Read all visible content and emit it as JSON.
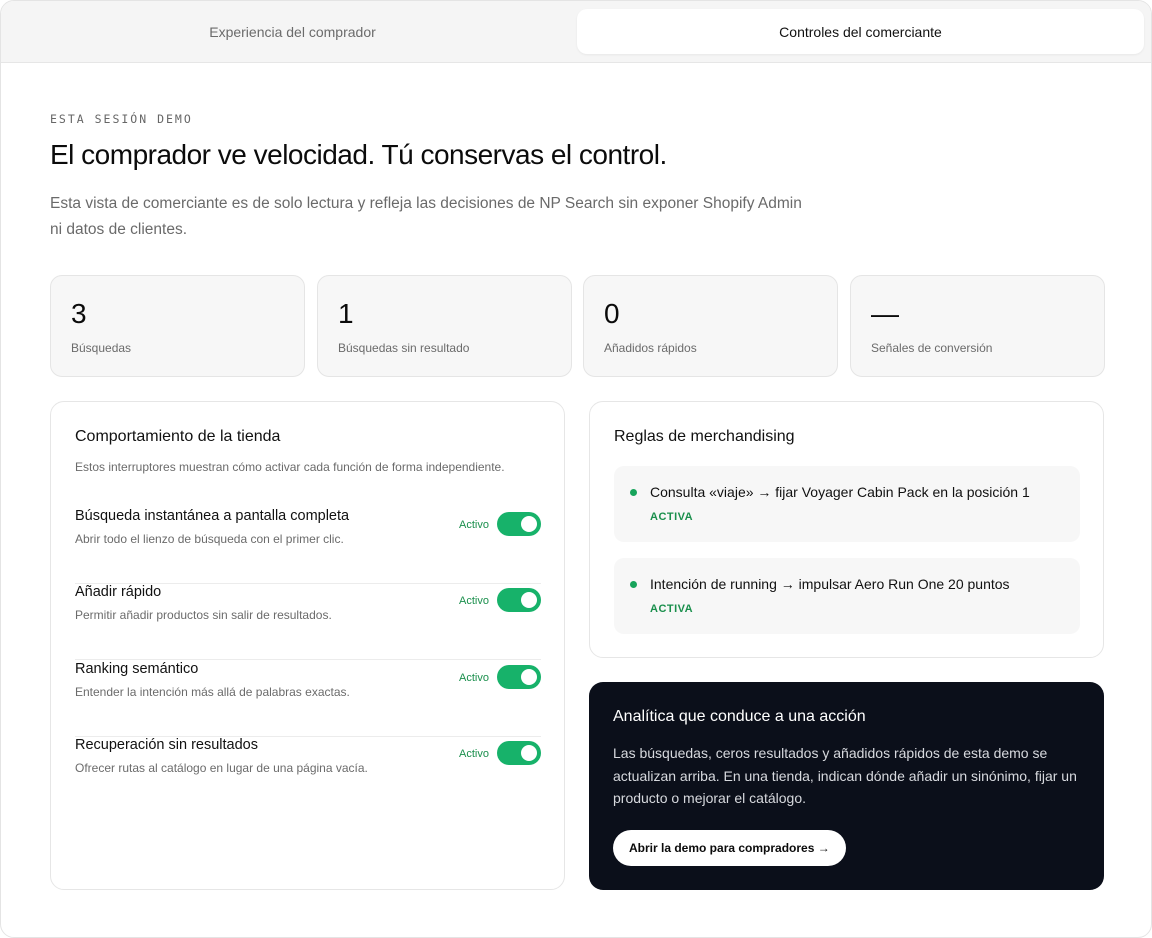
{
  "tabs": [
    {
      "label": "Experiencia del comprador",
      "active": false
    },
    {
      "label": "Controles del comerciante",
      "active": true
    }
  ],
  "header": {
    "eyebrow": "ESTA SESIÓN DEMO",
    "title": "El comprador ve velocidad. Tú conservas el control.",
    "subtitle": "Esta vista de comerciante es de solo lectura y refleja las decisiones de NP Search sin exponer Shopify Admin ni datos de clientes."
  },
  "stats": [
    {
      "value": "3",
      "label": "Búsquedas"
    },
    {
      "value": "1",
      "label": "Búsquedas sin resultado"
    },
    {
      "value": "0",
      "label": "Añadidos rápidos"
    },
    {
      "value": "—",
      "label": "Señales de conversión"
    }
  ],
  "behavior": {
    "title": "Comportamiento de la tienda",
    "subtitle": "Estos interruptores muestran cómo activar cada función de forma independiente.",
    "items": [
      {
        "title": "Búsqueda instantánea a pantalla completa",
        "description": "Abrir todo el lienzo de búsqueda con el primer clic.",
        "status": "Activo",
        "on": true
      },
      {
        "title": "Añadir rápido",
        "description": "Permitir añadir productos sin salir de resultados.",
        "status": "Activo",
        "on": true
      },
      {
        "title": "Ranking semántico",
        "description": "Entender la intención más allá de palabras exactas.",
        "status": "Activo",
        "on": true
      },
      {
        "title": "Recuperación sin resultados",
        "description": "Ofrecer rutas al catálogo en lugar de una página vacía.",
        "status": "Activo",
        "on": true
      }
    ]
  },
  "merch": {
    "title": "Reglas de merchandising",
    "rules": [
      {
        "text": "Consulta «viaje» → fijar Voyager Cabin Pack en la posición 1",
        "status": "ACTIVA"
      },
      {
        "text": "Intención de running → impulsar Aero Run One 20 puntos",
        "status": "ACTIVA"
      }
    ]
  },
  "analytics": {
    "title": "Analítica que conduce a una acción",
    "body": "Las búsquedas, ceros resultados y añadidos rápidos de esta demo se actualizan arriba. En una tienda, indican dónde añadir un sinónimo, fijar un producto o mejorar el catálogo.",
    "cta": "Abrir la demo para compradores →"
  },
  "colors": {
    "accent_green": "#17b26a",
    "status_text": "#1a8f4c",
    "dark_panel": "#0b0f1a"
  }
}
